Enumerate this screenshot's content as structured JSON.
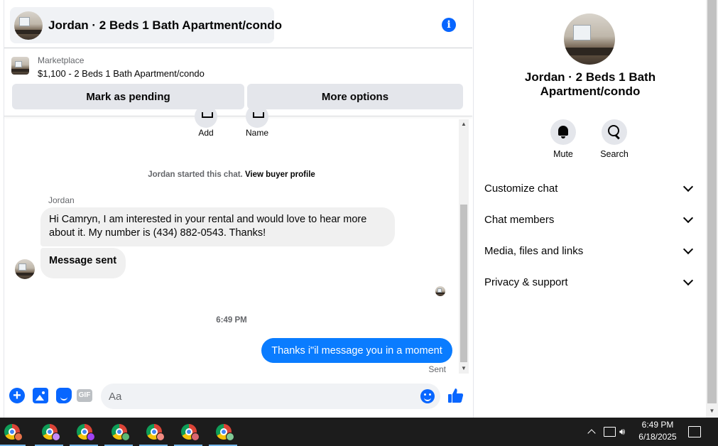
{
  "header": {
    "title": "Jordan · 2 Beds 1 Bath Apartment/condo",
    "info_icon": "i"
  },
  "marketplace": {
    "source": "Marketplace",
    "listing": "$1,100 - 2 Beds 1 Bath Apartment/condo"
  },
  "actions": {
    "mark_pending": "Mark as pending",
    "more_options": "More options"
  },
  "quick_actions": [
    {
      "label": "Add"
    },
    {
      "label": "Name"
    }
  ],
  "chat": {
    "system_prefix": "Jordan started this chat.",
    "system_link": "View buyer profile",
    "sender_name": "Jordan",
    "messages_in": [
      "Hi Camryn, I am interested in your rental and would love to hear more about it. My number is (434) 882-0543. Thanks!",
      "Message sent"
    ],
    "timestamp": "6:49 PM",
    "message_out": "Thanks i\"il message you in a moment",
    "status": "Sent"
  },
  "composer": {
    "placeholder": "Aa",
    "gif_label": "GIF",
    "plus_label": "+"
  },
  "right_panel": {
    "title": "Jordan · 2 Beds 1 Bath Apartment/condo",
    "mute_label": "Mute",
    "search_label": "Search",
    "sections": [
      "Customize chat",
      "Chat members",
      "Media, files and links",
      "Privacy & support"
    ]
  },
  "taskbar": {
    "apps": [
      {
        "icon": "chrome-icon",
        "badge_color": "#e8734a"
      },
      {
        "icon": "chrome-icon",
        "badge_color": "#c58af9"
      },
      {
        "icon": "chrome-icon",
        "badge_color": "#a142f4"
      },
      {
        "icon": "chrome-icon",
        "badge_color": "#5bb974"
      },
      {
        "icon": "chrome-icon",
        "badge_color": "#f28b82"
      },
      {
        "icon": "chrome-icon",
        "badge_color": "#d96570"
      },
      {
        "icon": "chrome-icon",
        "badge_color": "#81c995"
      }
    ],
    "time": "6:49 PM",
    "date": "6/18/2025"
  },
  "colors": {
    "accent": "#0866ff",
    "outgoing_bubble": "#0a7cff",
    "incoming_bubble": "#f0f0f0",
    "button_bg": "#e4e6eb",
    "taskbar_bg": "#1c1c1c"
  }
}
